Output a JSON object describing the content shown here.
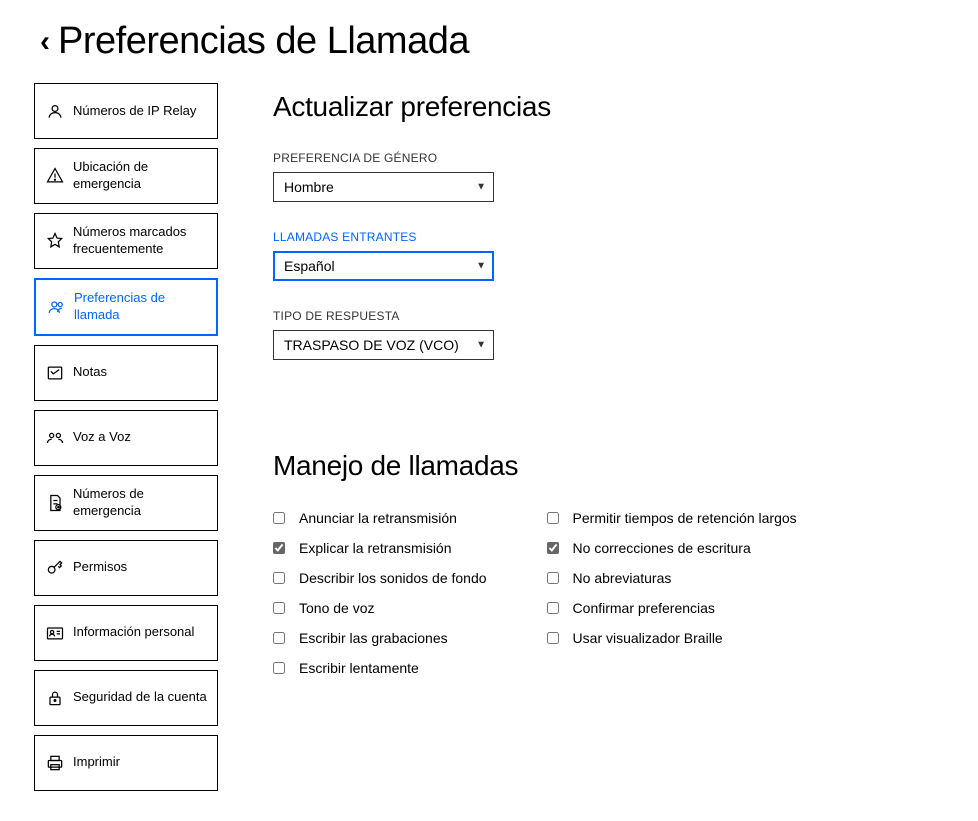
{
  "header": {
    "title": "Preferencias de Llamada"
  },
  "sidebar": {
    "items": [
      {
        "label": "Números de IP Relay",
        "icon": "people-icon"
      },
      {
        "label": "Ubicación de emergencia",
        "icon": "warning-icon"
      },
      {
        "label": "Números marcados frecuentemente",
        "icon": "star-icon"
      },
      {
        "label": "Preferencias de llamada",
        "icon": "people-icon",
        "active": true
      },
      {
        "label": "Notas",
        "icon": "note-icon"
      },
      {
        "label": "Voz a Voz",
        "icon": "voice-icon"
      },
      {
        "label": "Números de emergencia",
        "icon": "doc-icon"
      },
      {
        "label": "Permisos",
        "icon": "key-icon"
      },
      {
        "label": "Información personal",
        "icon": "id-icon"
      },
      {
        "label": "Seguridad de la cuenta",
        "icon": "lock-icon"
      },
      {
        "label": "Imprimir",
        "icon": "print-icon"
      }
    ]
  },
  "section1": {
    "title": "Actualizar preferencias",
    "gender": {
      "label": "PREFERENCIA DE GÉNERO",
      "value": "Hombre"
    },
    "incoming": {
      "label": "LLAMADAS ENTRANTES",
      "value": "Español"
    },
    "answer": {
      "label": "TIPO DE RESPUESTA",
      "value": "TRASPASO DE VOZ (VCO)"
    }
  },
  "section2": {
    "title": "Manejo de llamadas",
    "col1": [
      {
        "label": "Anunciar la retransmisión",
        "checked": false
      },
      {
        "label": "Explicar la retransmisión",
        "checked": true
      },
      {
        "label": "Describir los sonidos de fondo",
        "checked": false
      },
      {
        "label": "Tono de voz",
        "checked": false
      },
      {
        "label": "Escribir las grabaciones",
        "checked": false
      },
      {
        "label": "Escribir lentamente",
        "checked": false
      }
    ],
    "col2": [
      {
        "label": "Permitir tiempos de retención largos",
        "checked": false
      },
      {
        "label": "No correcciones de escritura",
        "checked": true
      },
      {
        "label": "No abreviaturas",
        "checked": false
      },
      {
        "label": "Confirmar preferencias",
        "checked": false
      },
      {
        "label": "Usar visualizador Braille",
        "checked": false
      }
    ]
  }
}
